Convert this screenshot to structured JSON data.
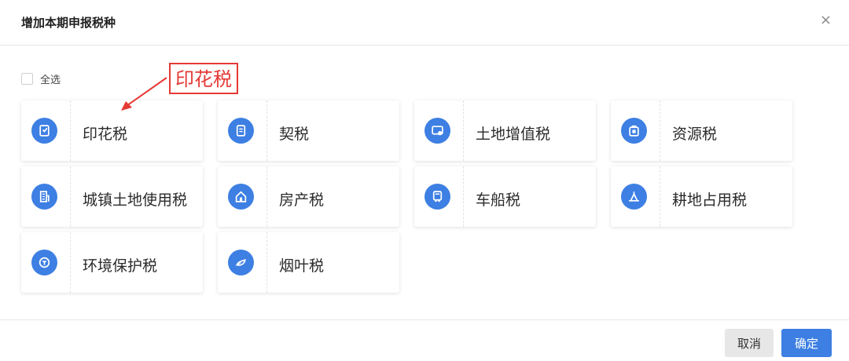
{
  "dialog": {
    "title": "增加本期申报税种",
    "close_glyph": "×"
  },
  "select_all": {
    "label": "全选",
    "checked": false
  },
  "annotation": {
    "text": "印花税",
    "color": "#e53935"
  },
  "taxes": [
    {
      "label": "印花税",
      "icon": "stamp-icon"
    },
    {
      "label": "契税",
      "icon": "document-icon"
    },
    {
      "label": "土地增值税",
      "icon": "land-value-icon"
    },
    {
      "label": "资源税",
      "icon": "resource-icon"
    },
    {
      "label": "城镇土地使用税",
      "icon": "building-icon"
    },
    {
      "label": "房产税",
      "icon": "house-icon"
    },
    {
      "label": "车船税",
      "icon": "vehicle-icon"
    },
    {
      "label": "耕地占用税",
      "icon": "farmland-icon"
    },
    {
      "label": "环境保护税",
      "icon": "environment-icon"
    },
    {
      "label": "烟叶税",
      "icon": "tobacco-icon"
    }
  ],
  "footer": {
    "cancel_label": "取消",
    "ok_label": "确定"
  },
  "colors": {
    "accent": "#3d7fe3",
    "annotation": "#e53935"
  }
}
